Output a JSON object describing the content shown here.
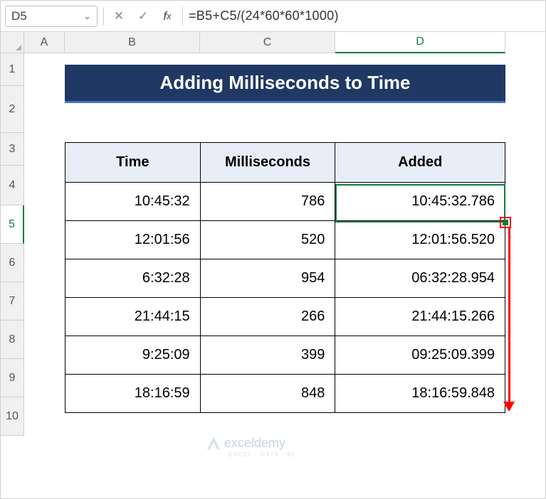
{
  "formula_bar": {
    "cell_ref": "D5",
    "formula": "=B5+C5/(24*60*60*1000)"
  },
  "columns": {
    "A": "A",
    "B": "B",
    "C": "C",
    "D": "D"
  },
  "rows": [
    "1",
    "2",
    "3",
    "4",
    "5",
    "6",
    "7",
    "8",
    "9",
    "10"
  ],
  "title": "Adding Milliseconds to Time",
  "table": {
    "headers": {
      "time": "Time",
      "ms": "Milliseconds",
      "added": "Added"
    },
    "data": [
      {
        "time": "10:45:32",
        "ms": "786",
        "added": "10:45:32.786"
      },
      {
        "time": "12:01:56",
        "ms": "520",
        "added": "12:01:56.520"
      },
      {
        "time": "6:32:28",
        "ms": "954",
        "added": "06:32:28.954"
      },
      {
        "time": "21:44:15",
        "ms": "266",
        "added": "21:44:15.266"
      },
      {
        "time": "9:25:09",
        "ms": "399",
        "added": "09:25:09.399"
      },
      {
        "time": "18:16:59",
        "ms": "848",
        "added": "18:16:59.848"
      }
    ]
  },
  "watermark": {
    "brand": "exceldemy",
    "sub": "EXCEL · DATA · BI"
  }
}
